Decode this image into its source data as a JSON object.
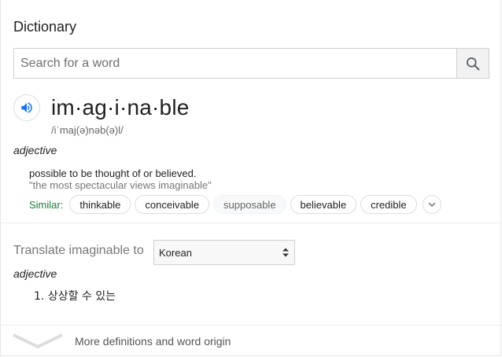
{
  "header": {
    "title": "Dictionary"
  },
  "search": {
    "placeholder": "Search for a word",
    "button_icon": "search-icon"
  },
  "entry": {
    "headword": "im·ag·i·na·ble",
    "phonetic": "/iˈmaj(ə)nəb(ə)l/",
    "audio_icon": "speaker-icon",
    "part_of_speech": "adjective",
    "definition": "possible to be thought of or believed.",
    "example": "\"the most spectacular views imaginable\"",
    "similar_label": "Similar:",
    "similar": [
      "thinkable",
      "conceivable",
      "supposable",
      "believable",
      "credible"
    ]
  },
  "translate": {
    "label": "Translate imaginable to",
    "language": "Korean",
    "part_of_speech": "adjective",
    "items": [
      "1. 상상할 수 있는"
    ]
  },
  "footer": {
    "more_label": "More definitions and word origin"
  },
  "colors": {
    "accent_green": "#188038",
    "speaker_blue": "#1a73e8"
  }
}
